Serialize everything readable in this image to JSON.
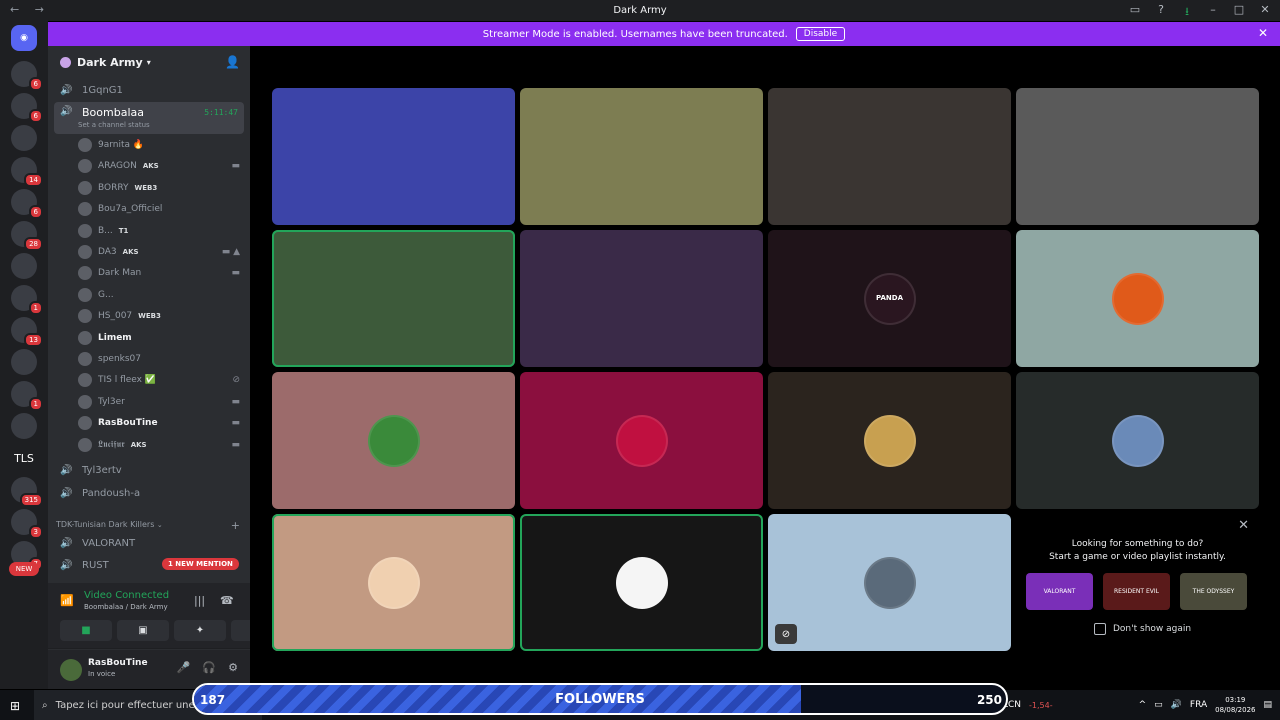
{
  "titlebar": {
    "title": "Dark Army",
    "nav": "← →"
  },
  "banner": {
    "text": "Streamer Mode is enabled. Usernames have been truncated.",
    "button": "Disable"
  },
  "servers": [
    {
      "badge": "6"
    },
    {
      "badge": "6"
    },
    {
      "badge": ""
    },
    {
      "badge": "14"
    },
    {
      "badge": "6"
    },
    {
      "badge": "28"
    },
    {
      "badge": ""
    },
    {
      "badge": "1"
    },
    {
      "badge": "13"
    },
    {
      "badge": ""
    },
    {
      "badge": "1"
    },
    {
      "badge": ""
    },
    {
      "label": "TLS"
    },
    {
      "badge": "315"
    },
    {
      "badge": "3"
    },
    {
      "badge": "7"
    }
  ],
  "server_new_label": "NEW",
  "guild": {
    "name": "Dark Army"
  },
  "channels": {
    "ch1": "1GqnG1",
    "active": {
      "name": "Boombalaa",
      "timer": "5:11:47",
      "status": "Set a channel status"
    },
    "ch3": "Tyl3ertv",
    "ch4": "Pandoush-a",
    "category": "TDK-Tunisian Dark Killers",
    "ch5": "VALORANT",
    "ch6": "RUST",
    "mention": "1 NEW MENTION"
  },
  "users": [
    {
      "name": "9arnita 🔥",
      "tag": ""
    },
    {
      "name": "ARAGON",
      "tag": "AKS"
    },
    {
      "name": "BORRY",
      "tag": "WEB3"
    },
    {
      "name": "Bou7a_Officiel",
      "tag": ""
    },
    {
      "name": "B...",
      "tag": "T1"
    },
    {
      "name": "DA3",
      "tag": "AKS"
    },
    {
      "name": "Dark Man",
      "tag": ""
    },
    {
      "name": "G...",
      "tag": ""
    },
    {
      "name": "HS_007",
      "tag": "WEB3"
    },
    {
      "name": "Limem",
      "tag": ""
    },
    {
      "name": "spenks07",
      "tag": ""
    },
    {
      "name": "TIS l fleex ✅",
      "tag": ""
    },
    {
      "name": "Tyl3er",
      "tag": ""
    },
    {
      "name": "RasBouTine",
      "tag": ""
    },
    {
      "name": "𝕷𝖚𝖈𝖎𝖋𝖚𝖗",
      "tag": "AKS"
    }
  ],
  "voice": {
    "status": "Video Connected",
    "location": "Boombalaa / Dark Army"
  },
  "panel": {
    "name": "RasBouTine",
    "status": "In voice"
  },
  "tiles": [
    {
      "color": "#3c44a8"
    },
    {
      "color": "#7d7d52"
    },
    {
      "color": "#3a3532"
    },
    {
      "color": "#5a5a5a"
    },
    {
      "color": "#3d5a3a"
    },
    {
      "color": "#3a2a48"
    },
    {
      "color": "#1f1319"
    },
    {
      "color": "#8fa7a3"
    },
    {
      "color": "#9c6b6b"
    },
    {
      "color": "#8b0f3e"
    },
    {
      "color": "#2b241e"
    },
    {
      "color": "#262b2a"
    },
    {
      "color": "#c29a82"
    },
    {
      "color": "#161616"
    },
    {
      "color": "#a8c2d8"
    }
  ],
  "tile_avatar_text": "PANDA",
  "suggest": {
    "line1": "Looking for something to do?",
    "line2": "Start a game or video playlist instantly.",
    "thumbs": [
      "VALORANT",
      "RESIDENT EVIL",
      "THE ODYSSEY"
    ],
    "dont_show": "Don't show again"
  },
  "taskbar": {
    "search_placeholder": "Tapez ici pour effectuer une re",
    "stock": "ALCN",
    "stock_change": "-1,54-",
    "lang": "FRA",
    "time": "03:19",
    "date": "08/08/2026"
  },
  "followers": {
    "label": "FOLLOWERS",
    "current": "187",
    "goal": "250",
    "progress": 0.748
  }
}
